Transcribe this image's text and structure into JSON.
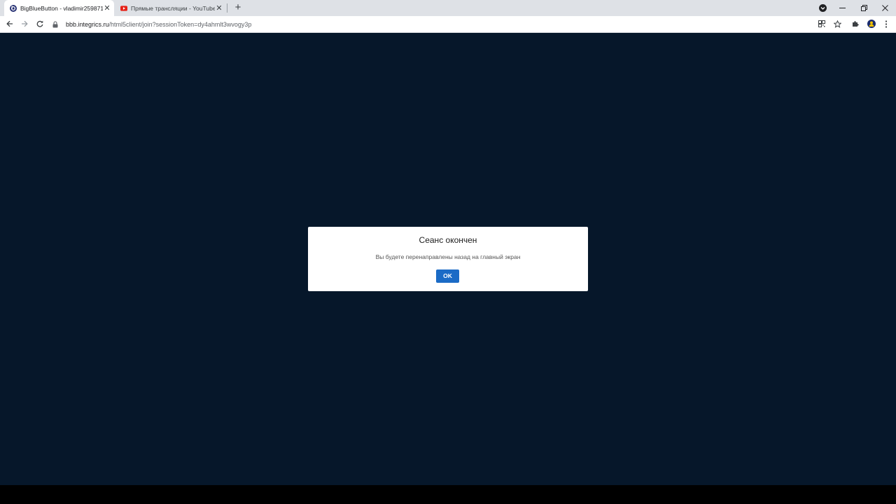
{
  "browser": {
    "tabs": [
      {
        "title": "BigBlueButton - vladimir259871",
        "active": true,
        "favicon": "bigbluebutton-icon"
      },
      {
        "title": "Прямые трансляции - YouTube",
        "active": false,
        "favicon": "youtube-icon"
      }
    ],
    "url": {
      "host": "bbb.integrics.ru",
      "path": "/html5client/join?sessionToken=dy4ahmlt3wvogy3p"
    }
  },
  "dialog": {
    "title": "Сеанс окончен",
    "message": "Вы будете перенаправлены назад на главный экран",
    "ok_label": "OK"
  },
  "colors": {
    "page_background": "#06172a",
    "ok_button": "#1b6bc6"
  }
}
